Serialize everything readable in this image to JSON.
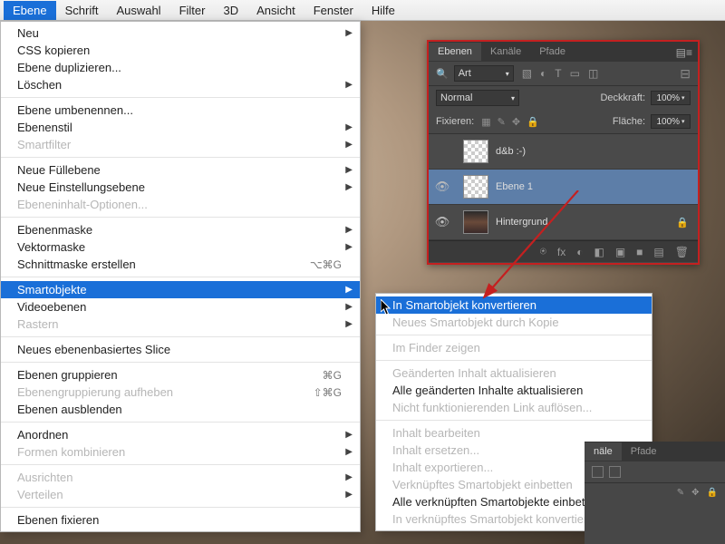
{
  "menubar": {
    "items": [
      "Ebene",
      "Schrift",
      "Auswahl",
      "Filter",
      "3D",
      "Ansicht",
      "Fenster",
      "Hilfe"
    ]
  },
  "dropdown": {
    "items": [
      {
        "label": "Neu",
        "arrow": true
      },
      {
        "label": "CSS kopieren"
      },
      {
        "label": "Ebene duplizieren..."
      },
      {
        "label": "Löschen",
        "arrow": true
      },
      {
        "sep": true
      },
      {
        "label": "Ebene umbenennen..."
      },
      {
        "label": "Ebenenstil",
        "arrow": true
      },
      {
        "label": "Smartfilter",
        "arrow": true,
        "disabled": true
      },
      {
        "sep": true
      },
      {
        "label": "Neue Füllebene",
        "arrow": true
      },
      {
        "label": "Neue Einstellungsebene",
        "arrow": true
      },
      {
        "label": "Ebeneninhalt-Optionen...",
        "disabled": true
      },
      {
        "sep": true
      },
      {
        "label": "Ebenenmaske",
        "arrow": true
      },
      {
        "label": "Vektormaske",
        "arrow": true
      },
      {
        "label": "Schnittmaske erstellen",
        "shortcut": "⌥⌘G"
      },
      {
        "sep": true
      },
      {
        "label": "Smartobjekte",
        "arrow": true,
        "highlighted": true
      },
      {
        "label": "Videoebenen",
        "arrow": true
      },
      {
        "label": "Rastern",
        "arrow": true,
        "disabled": true
      },
      {
        "sep": true
      },
      {
        "label": "Neues ebenenbasiertes Slice"
      },
      {
        "sep": true
      },
      {
        "label": "Ebenen gruppieren",
        "shortcut": "⌘G"
      },
      {
        "label": "Ebenengruppierung aufheben",
        "shortcut": "⇧⌘G",
        "disabled": true
      },
      {
        "label": "Ebenen ausblenden"
      },
      {
        "sep": true
      },
      {
        "label": "Anordnen",
        "arrow": true
      },
      {
        "label": "Formen kombinieren",
        "arrow": true,
        "disabled": true
      },
      {
        "sep": true
      },
      {
        "label": "Ausrichten",
        "arrow": true,
        "disabled": true
      },
      {
        "label": "Verteilen",
        "arrow": true,
        "disabled": true
      },
      {
        "sep": true
      },
      {
        "label": "Ebenen fixieren"
      }
    ]
  },
  "submenu": {
    "items": [
      {
        "label": "In Smartobjekt konvertieren",
        "highlighted": true
      },
      {
        "label": "Neues Smartobjekt durch Kopie",
        "disabled": true
      },
      {
        "sep": true
      },
      {
        "label": "Im Finder zeigen",
        "disabled": true
      },
      {
        "sep": true
      },
      {
        "label": "Geänderten Inhalt aktualisieren",
        "disabled": true
      },
      {
        "label": "Alle geänderten Inhalte aktualisieren"
      },
      {
        "label": "Nicht funktionierenden Link auflösen...",
        "disabled": true
      },
      {
        "sep": true
      },
      {
        "label": "Inhalt bearbeiten",
        "disabled": true
      },
      {
        "label": "Inhalt ersetzen...",
        "disabled": true
      },
      {
        "label": "Inhalt exportieren...",
        "disabled": true
      },
      {
        "label": "Verknüpftes Smartobjekt einbetten",
        "disabled": true
      },
      {
        "label": "Alle verknüpften Smartobjekte einbetten"
      },
      {
        "label": "In verknüpftes Smartobjekt konvertieren...",
        "disabled": true
      }
    ]
  },
  "layersPanel": {
    "tabs": [
      "Ebenen",
      "Kanäle",
      "Pfade"
    ],
    "kind": "Art",
    "blendMode": "Normal",
    "opacityLabel": "Deckkraft:",
    "opacity": "100%",
    "lockLabel": "Fixieren:",
    "fillLabel": "Fläche:",
    "fill": "100%",
    "layers": [
      {
        "name": "d&b :-)",
        "visible": false,
        "checker": true
      },
      {
        "name": "Ebene 1",
        "visible": true,
        "checker": true,
        "selected": true
      },
      {
        "name": "Hintergrund",
        "visible": true,
        "locked": true,
        "photo": true
      }
    ],
    "bottomIcons": [
      "⍟",
      "fx",
      "◐",
      "◧",
      "▣",
      "■",
      "▤",
      "🗑"
    ]
  },
  "auxPanel": {
    "tabs": [
      "näle",
      "Pfade"
    ]
  }
}
